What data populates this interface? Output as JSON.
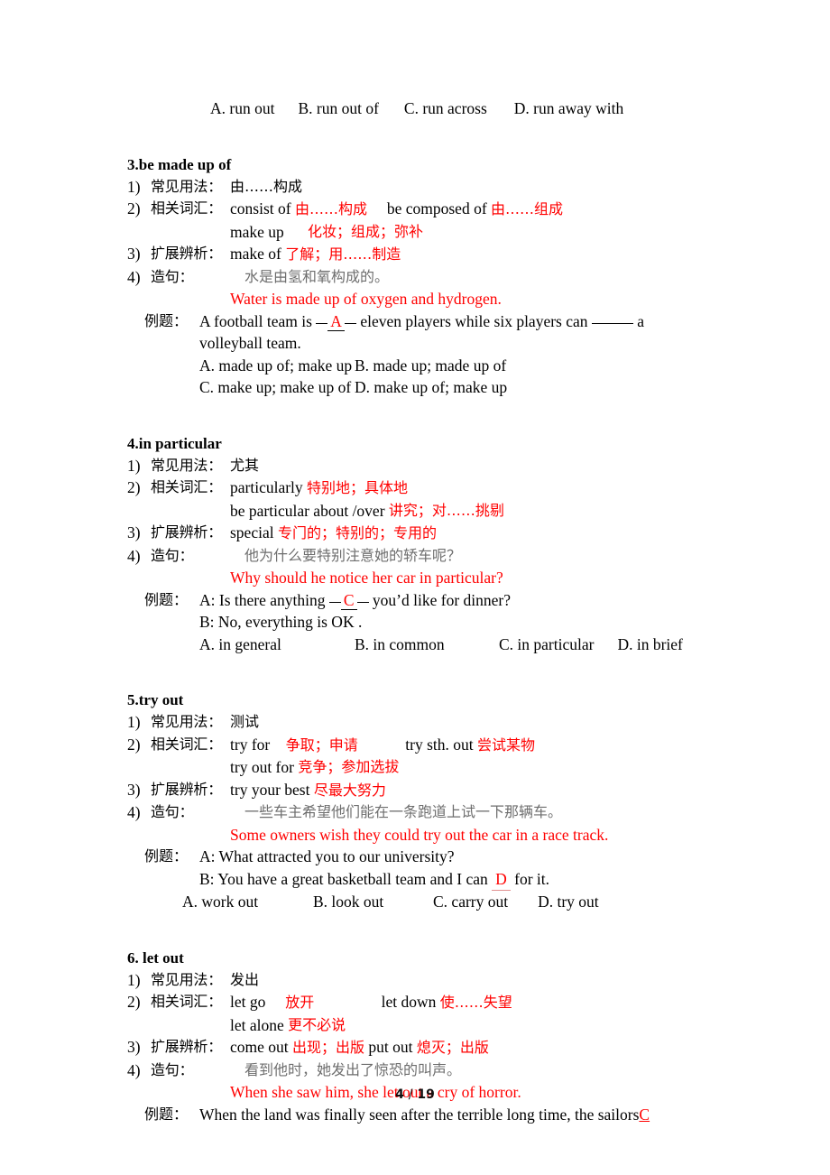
{
  "page": {
    "footer_page": "4",
    "footer_sep": "/",
    "footer_total": "19",
    "accent_red": "#ff0000",
    "text_black": "#000000",
    "text_grey": "#6e6e6e"
  },
  "top_options": {
    "a": "A. run out",
    "b": "B. run out of",
    "c": "C. run across",
    "d": "D. run away with"
  },
  "entries": [
    {
      "heading": "3.be made up of",
      "rows": [
        {
          "num": "1)",
          "label": "常见用法：",
          "value_cn": "由……构成"
        },
        {
          "num": "2)",
          "label": "相关词汇：",
          "en1": "consist of",
          "cn1": "由……构成",
          "en2": "be composed of",
          "cn2": "由……组成"
        },
        {
          "cont_en": "make up",
          "cont_cn": "化妆；组成；弥补"
        },
        {
          "num": "3)",
          "label": "扩展辨析：",
          "en1": "make of",
          "cn1": "了解；用……制造"
        },
        {
          "num": "4)",
          "label": "造句：",
          "cn_sentence": "水是由氢和氧构成的。"
        },
        {
          "red_sentence": "Water is made up of oxygen and hydrogen."
        }
      ],
      "example": {
        "label": "例题：",
        "stem_part1": "A football team is",
        "answer": "A",
        "stem_part2": "eleven players while six players can",
        "stem_part3": "a",
        "stem_line2": "volleyball team.",
        "choices": [
          "A. made up of; make up",
          "B. made up; made up of",
          "C. make up; make up of",
          "D. make up of; make up"
        ]
      }
    },
    {
      "heading": "4.in particular",
      "rows": [
        {
          "num": "1)",
          "label": "常见用法：",
          "value_cn": "尤其"
        },
        {
          "num": "2)",
          "label": "相关词汇：",
          "en1": "particularly",
          "cn1": "特别地；具体地"
        },
        {
          "cont_en": "be particular about /over",
          "cont_cn": "讲究；对……挑剔"
        },
        {
          "num": "3)",
          "label": "扩展辨析：",
          "en1": "special",
          "cn1": "专门的；特别的；专用的"
        },
        {
          "num": "4)",
          "label": "造句：",
          "cn_sentence": "他为什么要特别注意她的轿车呢？"
        },
        {
          "red_sentence": "Why should he notice her car in particular?"
        }
      ],
      "example": {
        "label": "例题：",
        "line_a_pre": "A: Is there anything",
        "answer": "C",
        "line_a_post": "you’d like for dinner?",
        "line_b": "B: No, everything is OK .",
        "choices": [
          "A. in general",
          "B. in common",
          "C. in particular",
          "D. in brief"
        ]
      }
    },
    {
      "heading": "5.try out",
      "rows": [
        {
          "num": "1)",
          "label": "常见用法：",
          "value_cn": "测试"
        },
        {
          "num": "2)",
          "label": "相关词汇：",
          "en1": "try for",
          "cn1": "争取；申请",
          "en2": "try sth. out",
          "cn2": "尝试某物"
        },
        {
          "cont_en": "try out for",
          "cont_cn": "竞争；参加选拔"
        },
        {
          "num": "3)",
          "label": "扩展辨析：",
          "en1": "try your best",
          "cn1": "尽最大努力"
        },
        {
          "num": "4)",
          "label": "造句：",
          "cn_sentence": "一些车主希望他们能在一条跑道上试一下那辆车。"
        },
        {
          "red_sentence": "Some owners wish they could try out the car in a race track."
        }
      ],
      "example": {
        "label": "例题：",
        "line_a": "A: What attracted you to our university?",
        "line_b_pre": "B: You have a great basketball team and I can",
        "answer": "D",
        "line_b_post": "for it.",
        "choices": [
          "A. work out",
          "B. look out",
          "C. carry out",
          "D. try out"
        ]
      }
    },
    {
      "heading": "6. let out",
      "rows": [
        {
          "num": "1)",
          "label": "常见用法：",
          "value_cn": "发出"
        },
        {
          "num": "2)",
          "label": "相关词汇：",
          "en1": "let go",
          "cn1": "放开",
          "en2": "let down",
          "cn2": "使……失望"
        },
        {
          "cont_en": "let alone",
          "cont_cn": "更不必说"
        },
        {
          "num": "3)",
          "label": "扩展辨析：",
          "en1": "come out",
          "cn1": "出现；出版",
          "en2": "put out",
          "cn2": "熄灭；出版"
        },
        {
          "num": "4)",
          "label": "造句：",
          "cn_sentence": "看到他时，她发出了惊恐的叫声。"
        },
        {
          "red_sentence": "When she saw him, she let out a cry of horror."
        }
      ],
      "example": {
        "label": "例题：",
        "stem": "When the land was finally seen after the terrible long time, the sailors",
        "answer": "C"
      }
    }
  ]
}
